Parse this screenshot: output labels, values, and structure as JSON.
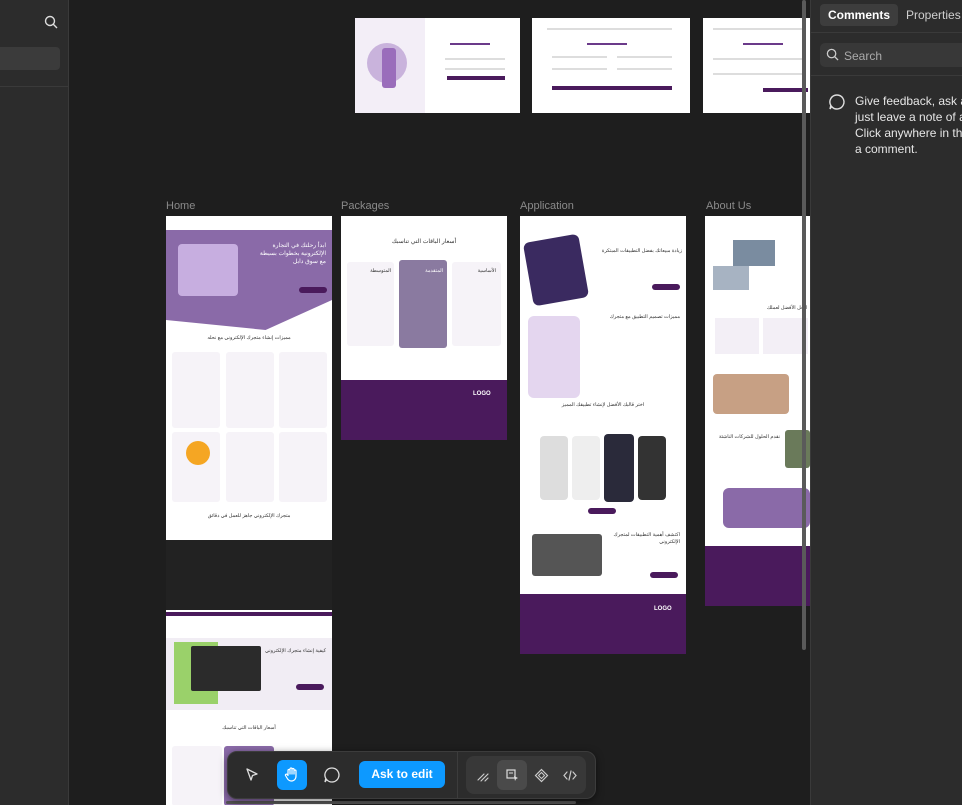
{
  "left_panel": {
    "search_icon": "search-icon"
  },
  "canvas": {
    "frames": [
      {
        "id": "home",
        "label": "Home"
      },
      {
        "id": "packages",
        "label": "Packages"
      },
      {
        "id": "application",
        "label": "Application"
      },
      {
        "id": "about",
        "label": "About Us"
      }
    ],
    "texts": {
      "home_hero": "ابدأ رحلتك في التجارة الإلكترونية بخطوات بسيطة مع سوق دابل",
      "home_features": "مميزات إنشاء متجرك الإلكتروني مع نحله",
      "home_ready": "متجرك الإلكتروني جاهز للعمل في دقائق",
      "home_how": "كيفية إنشاء متجرك الإلكتروني",
      "home_pricing": "أسعار الباقات التي تناسبك",
      "pkg_title": "أسعار الباقات التي تناسبك",
      "pkg_plan_basic": "الأساسية",
      "pkg_plan_pro": "المتقدمة",
      "pkg_plan_mid": "المتوسطة",
      "pkg_logo": "LOGO",
      "app_title": "زيادة مبيعاتك بفضل التطبيقات المبتكرة",
      "app_features": "مميزات تصميم التطبيق مع متجرك",
      "app_choose": "اختر قالبك الأفضل لإنشاء تطبيقك المميز",
      "app_discover": "اكتشف أهمية التطبيقات لمتجرك الإلكتروني",
      "app_logo": "LOGO",
      "about_best": "الحل الأفضل لعملك",
      "about_partners": "نقدم الحلول للشركات الناشئة"
    }
  },
  "right_panel": {
    "tabs": [
      "Comments",
      "Properties"
    ],
    "active_tab": "Comments",
    "search_placeholder": "Search",
    "empty_message_lines": [
      "Give feedback, ask a",
      "just leave a note of a",
      "Click anywhere in the",
      "a comment."
    ]
  },
  "toolbar": {
    "tools": [
      "pointer-tool",
      "hand-tool",
      "comment-tool"
    ],
    "active_tool": "hand-tool",
    "ask_label": "Ask to edit",
    "dev_tools": [
      "annotate-icon",
      "inspect-icon",
      "component-icon",
      "code-icon"
    ]
  },
  "colors": {
    "accent": "#0d99ff",
    "brand_purple": "#4a1a5c",
    "canvas": "#1e1e1e",
    "panel": "#2c2c2c"
  }
}
